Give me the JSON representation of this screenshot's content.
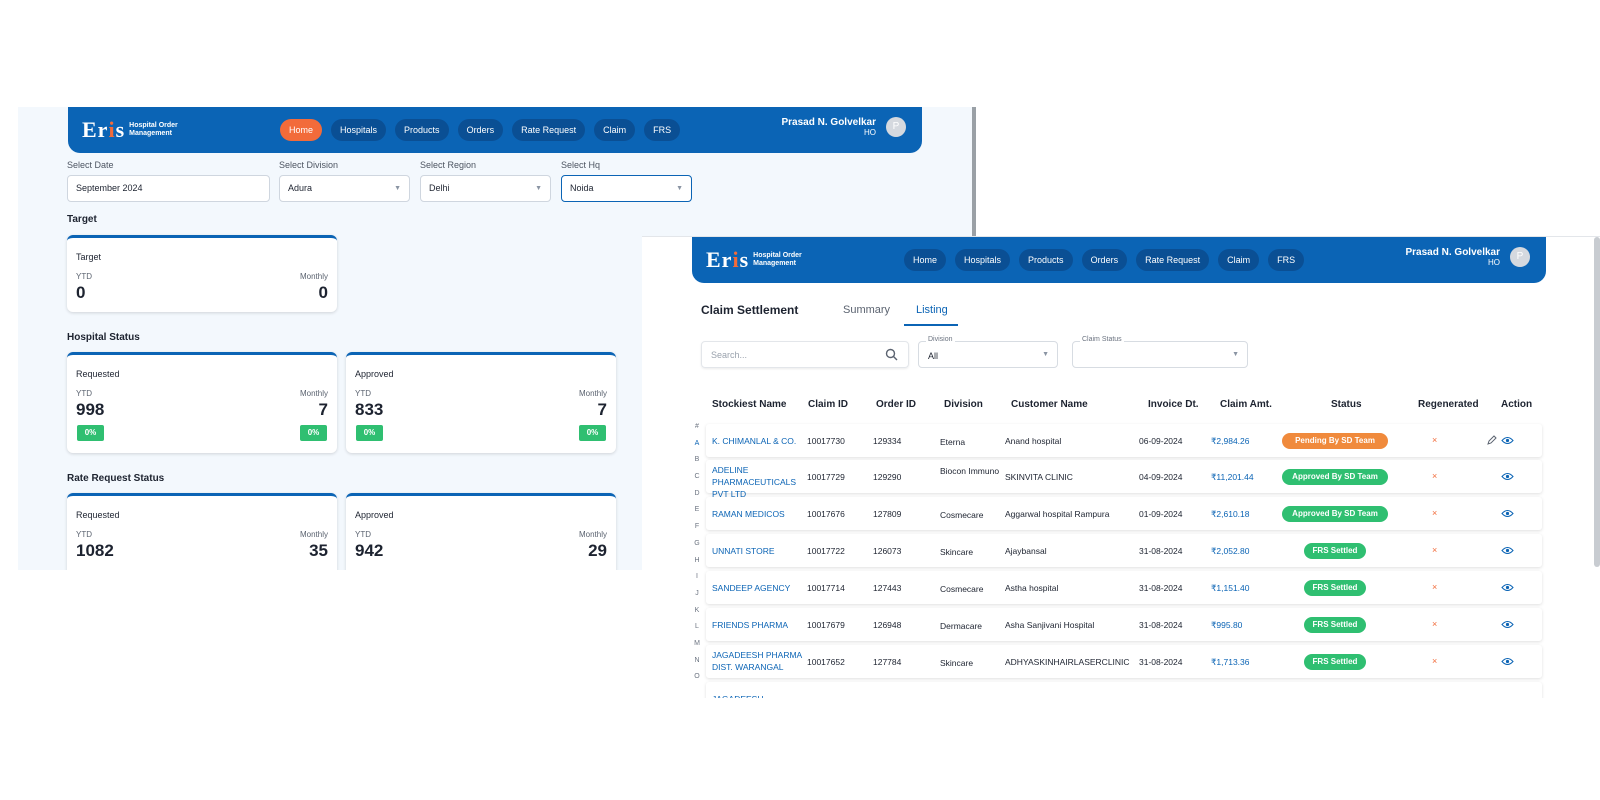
{
  "brand": {
    "logo_word": "Eris",
    "logo_sub_line1": "Hospital Order",
    "logo_sub_line2": "Management"
  },
  "nav_items": [
    "Home",
    "Hospitals",
    "Products",
    "Orders",
    "Rate Request",
    "Claim",
    "FRS"
  ],
  "user": {
    "name": "Prasad N. Golvelkar",
    "role": "HO",
    "initial": "P"
  },
  "colors": {
    "primary": "#0b64b5",
    "accent": "#f26b3a",
    "success": "#2fbf71"
  },
  "dashboard": {
    "filters": {
      "date_label": "Select Date",
      "date_value": "September 2024",
      "division_label": "Select Division",
      "division_value": "Adura",
      "region_label": "Select Region",
      "region_value": "Delhi",
      "hq_label": "Select Hq",
      "hq_value": "Noida"
    },
    "target_section": "Target",
    "target_card": {
      "title": "Target",
      "ytd_label": "YTD",
      "monthly_label": "Monthly",
      "ytd": "0",
      "monthly": "0"
    },
    "hospital_section": "Hospital Status",
    "hospital_cards": [
      {
        "title": "Requested",
        "ytd_label": "YTD",
        "monthly_label": "Monthly",
        "ytd": "998",
        "monthly": "7",
        "pct_left": "0%",
        "pct_right": "0%"
      },
      {
        "title": "Approved",
        "ytd_label": "YTD",
        "monthly_label": "Monthly",
        "ytd": "833",
        "monthly": "7",
        "pct_left": "0%",
        "pct_right": "0%"
      }
    ],
    "rate_section": "Rate Request Status",
    "rate_cards": [
      {
        "title": "Requested",
        "ytd_label": "YTD",
        "monthly_label": "Monthly",
        "ytd": "1082",
        "monthly": "35"
      },
      {
        "title": "Approved",
        "ytd_label": "YTD",
        "monthly_label": "Monthly",
        "ytd": "942",
        "monthly": "29"
      }
    ]
  },
  "claims": {
    "page_title": "Claim Settlement",
    "tabs": [
      "Summary",
      "Listing"
    ],
    "active_tab": "Listing",
    "search_placeholder": "Search...",
    "division_label": "Division",
    "division_value": "All",
    "claim_status_label": "Claim Status",
    "claim_status_value": "",
    "alphabet": [
      "#",
      "A",
      "B",
      "C",
      "D",
      "E",
      "F",
      "G",
      "H",
      "I",
      "J",
      "K",
      "L",
      "M",
      "N",
      "O"
    ],
    "selected_letter": "A",
    "columns": [
      "Stockiest Name",
      "Claim ID",
      "Order ID",
      "Division",
      "Customer Name",
      "Invoice Dt.",
      "Claim Amt.",
      "Status",
      "Regenerated",
      "Action"
    ],
    "regenerated_mark": "×",
    "rows": [
      {
        "stockiest": "K. CHIMANLAL & CO.",
        "claim_id": "10017730",
        "order_id": "129334",
        "division": "Eterna",
        "customer": "Anand hospital",
        "invoice_dt": "06-09-2024",
        "amount": "₹2,984.26",
        "status": "Pending By SD Team",
        "status_color": "#f08a3c",
        "editable": true
      },
      {
        "stockiest": "ADELINE PHARMACEUTICALS PVT LTD",
        "claim_id": "10017729",
        "order_id": "129290",
        "division": "Biocon Immuno",
        "customer": "SKINVITA CLINIC",
        "invoice_dt": "04-09-2024",
        "amount": "₹11,201.44",
        "status": "Approved By SD Team",
        "status_color": "#2fbf71",
        "editable": false
      },
      {
        "stockiest": "RAMAN MEDICOS",
        "claim_id": "10017676",
        "order_id": "127809",
        "division": "Cosmecare",
        "customer": "Aggarwal hospital Rampura",
        "invoice_dt": "01-09-2024",
        "amount": "₹2,610.18",
        "status": "Approved By SD Team",
        "status_color": "#2fbf71",
        "editable": false
      },
      {
        "stockiest": "UNNATI STORE",
        "claim_id": "10017722",
        "order_id": "126073",
        "division": "Skincare",
        "customer": "Ajaybansal",
        "invoice_dt": "31-08-2024",
        "amount": "₹2,052.80",
        "status": "FRS Settled",
        "status_color": "#2fbf71",
        "editable": false
      },
      {
        "stockiest": "SANDEEP AGENCY",
        "claim_id": "10017714",
        "order_id": "127443",
        "division": "Cosmecare",
        "customer": "Astha hospital",
        "invoice_dt": "31-08-2024",
        "amount": "₹1,151.40",
        "status": "FRS Settled",
        "status_color": "#2fbf71",
        "editable": false
      },
      {
        "stockiest": "FRIENDS PHARMA",
        "claim_id": "10017679",
        "order_id": "126948",
        "division": "Dermacare",
        "customer": "Asha Sanjivani Hospital",
        "invoice_dt": "31-08-2024",
        "amount": "₹995.80",
        "status": "FRS Settled",
        "status_color": "#2fbf71",
        "editable": false
      },
      {
        "stockiest": "JAGADEESH PHARMA DIST. WARANGAL",
        "claim_id": "10017652",
        "order_id": "127784",
        "division": "Skincare",
        "customer": "ADHYASKINHAIRLASERCLINIC",
        "invoice_dt": "31-08-2024",
        "amount": "₹1,713.36",
        "status": "FRS Settled",
        "status_color": "#2fbf71",
        "editable": false
      },
      {
        "stockiest": "JAGADEESH",
        "claim_id": "",
        "order_id": "",
        "division": "",
        "customer": "",
        "invoice_dt": "",
        "amount": "",
        "status": "",
        "status_color": "#2fbf71",
        "editable": false
      }
    ]
  }
}
